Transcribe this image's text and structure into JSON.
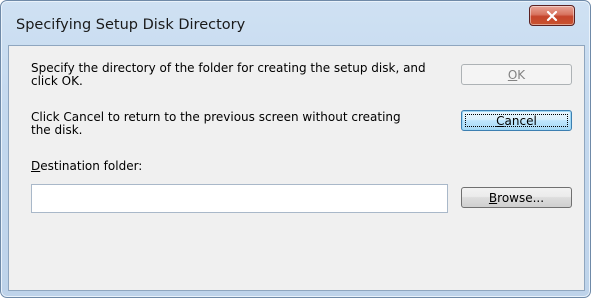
{
  "window": {
    "title": "Specifying Setup Disk Directory"
  },
  "content": {
    "instruction_1": "Specify the directory of the folder for creating the setup disk, and\nclick OK.",
    "instruction_2": "Click Cancel to return to the previous screen without creating\nthe disk.",
    "destination_label_key": "D",
    "destination_label_rest": "estination folder:",
    "destination_value": ""
  },
  "buttons": {
    "ok_key": "O",
    "ok_rest": "K",
    "cancel_key": "C",
    "cancel_rest": "ancel",
    "browse_key": "B",
    "browse_rest": "rowse..."
  },
  "icons": {
    "close": "close-icon"
  }
}
